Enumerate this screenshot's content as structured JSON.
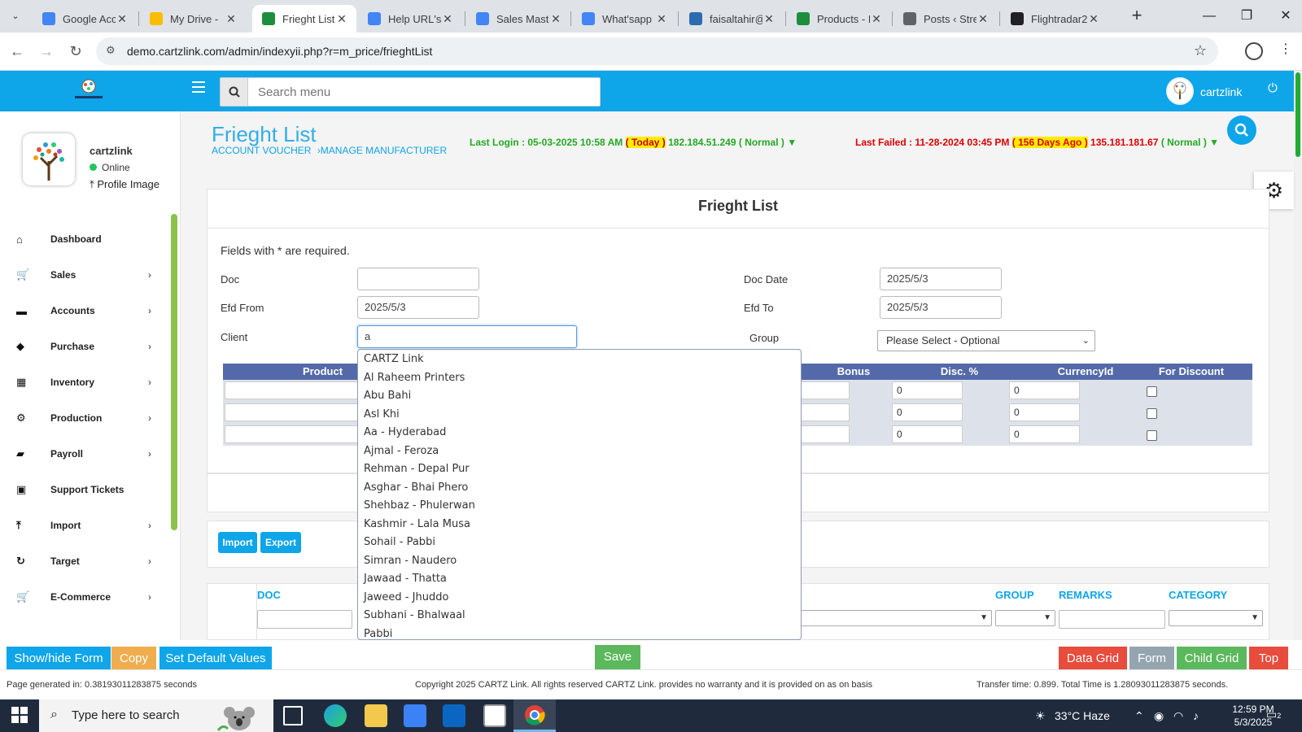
{
  "browser": {
    "tabs": [
      {
        "title": "Google Acc",
        "color": "#4285f4"
      },
      {
        "title": "My Drive -",
        "color": "#fbbc04"
      },
      {
        "title": "Frieght List",
        "color": "#1e8e3e",
        "active": true
      },
      {
        "title": "Help URL's",
        "color": "#4285f4"
      },
      {
        "title": "Sales Maste",
        "color": "#4285f4"
      },
      {
        "title": "What'sapp",
        "color": "#4285f4"
      },
      {
        "title": "faisaltahir@",
        "color": "#2b6cb0"
      },
      {
        "title": "Products - F",
        "color": "#1e8e3e"
      },
      {
        "title": "Posts ‹ Stre",
        "color": "#5f6368"
      },
      {
        "title": "Flightradar2",
        "color": "#202124"
      }
    ],
    "url": "demo.cartzlink.com/admin/indexyii.php?r=m_price/frieghtList"
  },
  "header": {
    "search_placeholder": "Search menu",
    "username": "cartzlink"
  },
  "sidebar": {
    "profile_name": "cartzlink",
    "status": "Online",
    "profile_link": "Profile Image",
    "items": [
      {
        "label": "Dashboard",
        "icon": "home-icon",
        "glyph": "⌂",
        "chevron": false
      },
      {
        "label": "Sales",
        "icon": "cart-icon",
        "glyph": "🛒",
        "chevron": true
      },
      {
        "label": "Accounts",
        "icon": "wallet-icon",
        "glyph": "▬",
        "chevron": true
      },
      {
        "label": "Purchase",
        "icon": "tags-icon",
        "glyph": "◆",
        "chevron": true
      },
      {
        "label": "Inventory",
        "icon": "grid-icon",
        "glyph": "▦",
        "chevron": true
      },
      {
        "label": "Production",
        "icon": "gears-icon",
        "glyph": "⚙",
        "chevron": true
      },
      {
        "label": "Payroll",
        "icon": "money-icon",
        "glyph": "▰",
        "chevron": true
      },
      {
        "label": "Support Tickets",
        "icon": "ticket-icon",
        "glyph": "▣",
        "chevron": false
      },
      {
        "label": "Import",
        "icon": "upload-icon",
        "glyph": "⤒",
        "chevron": true
      },
      {
        "label": "Target",
        "icon": "refresh-icon",
        "glyph": "↻",
        "chevron": true
      },
      {
        "label": "E-Commerce",
        "icon": "cart-icon",
        "glyph": "🛒",
        "chevron": true
      }
    ]
  },
  "page": {
    "title": "Frieght List",
    "breadcrumb_1": "ACCOUNT VOUCHER",
    "breadcrumb_2": "›MANAGE MANUFACTURER",
    "last_login_prefix": "Last Login : 05-03-2025 10:58 AM",
    "last_login_badge": "( Today )",
    "last_login_suffix": "182.184.51.249",
    "last_login_status": "( Normal ) ▼",
    "last_failed_prefix": "Last Failed : 11-28-2024 03:45 PM",
    "last_failed_badge": "( 156 Days Ago )",
    "last_failed_suffix": "135.181.181.67",
    "last_failed_status": "( Normal ) ▼"
  },
  "form": {
    "heading": "Frieght List",
    "required_note": "Fields with * are required.",
    "doc_label": "Doc",
    "doc_value": "",
    "doc_date_label": "Doc Date",
    "doc_date_value": "2025/5/3",
    "efd_from_label": "Efd From",
    "efd_from_value": "2025/5/3",
    "efd_to_label": "Efd To",
    "efd_to_value": "2025/5/3",
    "client_label": "Client",
    "client_value": "a",
    "group_label": "Group",
    "group_value": "Please Select - Optional"
  },
  "product_table": {
    "columns": [
      "Product",
      "Bonus",
      "Disc. %",
      "CurrencyId",
      "For Discount"
    ],
    "rows": [
      {
        "disc": "0",
        "currency": "0",
        "for_discount": false
      },
      {
        "disc": "0",
        "currency": "0",
        "for_discount": false
      },
      {
        "disc": "0",
        "currency": "0",
        "for_discount": false
      }
    ]
  },
  "autocomplete": [
    "CARTZ Link",
    "Al Raheem Printers",
    "Abu Bahi",
    "Asl Khi",
    "Aa - Hyderabad",
    "Ajmal - Feroza",
    "Rehman - Depal Pur",
    "Asghar - Bhai Phero",
    "Shehbaz - Phulerwan",
    "Kashmir - Lala Musa",
    "Sohail - Pabbi",
    "Simran - Naudero",
    "Jawaad - Thatta",
    "Jaweed - Jhuddo",
    "Subhani - Bhalwaal",
    "Pabbi"
  ],
  "actions": {
    "import": "Import",
    "export": "Export"
  },
  "grid": {
    "columns": [
      "DOC",
      "GROUP",
      "REMARKS",
      "CATEGORY"
    ]
  },
  "bottom_buttons": {
    "show_hide": "Show/hide Form",
    "copy": "Copy",
    "set_default": "Set Default Values",
    "save": "Save",
    "data_grid": "Data Grid",
    "form": "Form",
    "child_grid": "Child Grid",
    "top": "Top"
  },
  "footer": {
    "generated": "Page generated in: 0.38193011283875 seconds",
    "copyright": "Copyright 2025 CARTZ Link. All rights reserved CARTZ Link. provides no warranty and it is provided on as on basis",
    "transfer": "Transfer time: 0.899. Total Time is 1.28093011283875 seconds."
  },
  "taskbar": {
    "search_placeholder": "Type here to search",
    "weather": "33°C  Haze",
    "time": "12:59 PM",
    "date": "5/3/2025",
    "notifications": "2"
  },
  "colors": {
    "brand": "#0ea5e9",
    "table_header": "#5469a9",
    "sidebar_accent": "#8bc34a",
    "danger": "#e74c3c",
    "success": "#5cb85c",
    "warning": "#f0ad4e"
  }
}
